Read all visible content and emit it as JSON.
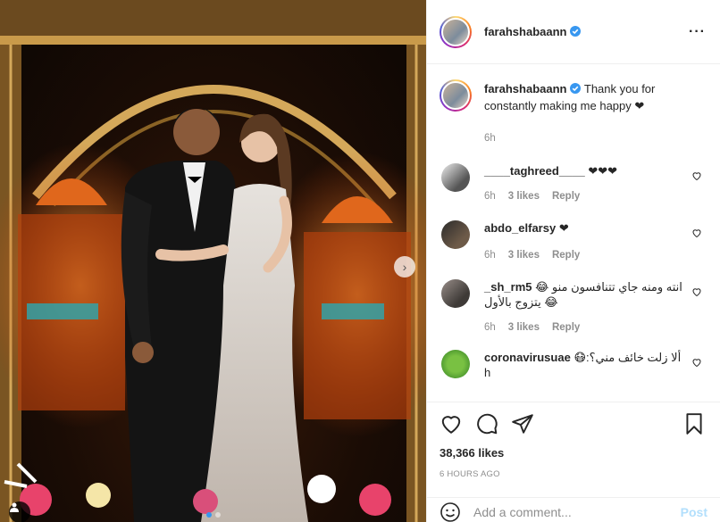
{
  "post": {
    "username": "farahshabaann",
    "verified": true,
    "more_icon": "more-horizontal-icon"
  },
  "caption": {
    "username": "farahshabaann",
    "text": "Thank you for constantly making me happy ❤",
    "time": "6h"
  },
  "comments": [
    {
      "username": "____taghreed____",
      "text": "❤❤❤",
      "time": "6h",
      "likes": "3 likes",
      "reply": "Reply"
    },
    {
      "username": "abdo_elfarsy",
      "text": "❤",
      "time": "6h",
      "likes": "3 likes",
      "reply": "Reply"
    },
    {
      "username": "_sh_rm5",
      "text": "انته ومنه جاي تتنافسون منو 😂😂 يتزوج بالأول",
      "time": "6h",
      "likes": "3 likes",
      "reply": "Reply"
    },
    {
      "username": "coronavirusuae",
      "text": "ألا زلت خائف مني؟:😷h",
      "time": "",
      "likes": "",
      "reply": ""
    }
  ],
  "actions": {
    "likes": "38,366 likes",
    "timestamp": "6 HOURS AGO"
  },
  "add_comment": {
    "placeholder": "Add a comment...",
    "post_label": "Post"
  },
  "colors": {
    "verified_blue": "#3897f0",
    "post_disabled": "#b2dffc",
    "meta_gray": "#8e8e8e"
  }
}
